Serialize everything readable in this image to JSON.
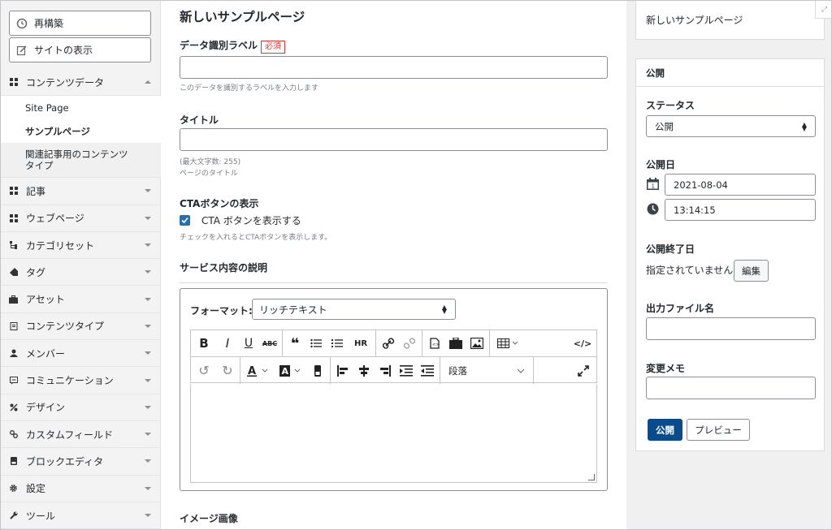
{
  "sidebar": {
    "rebuild_label": "再構築",
    "view_site_label": "サイトの表示",
    "content_data_label": "コンテンツデータ",
    "sub_items": {
      "site_page": "Site Page",
      "sample_page": "サンプルページ",
      "related": "関連記事用のコンテンツタイプ"
    },
    "items": [
      {
        "label": "記事",
        "icon": "grid-icon"
      },
      {
        "label": "ウェブページ",
        "icon": "grid-icon"
      },
      {
        "label": "カテゴリセット",
        "icon": "hierarchy-icon"
      },
      {
        "label": "タグ",
        "icon": "tag-icon"
      },
      {
        "label": "アセット",
        "icon": "briefcase-icon"
      },
      {
        "label": "コンテンツタイプ",
        "icon": "document-icon"
      },
      {
        "label": "メンバー",
        "icon": "user-icon"
      },
      {
        "label": "コミュニケーション",
        "icon": "chat-icon"
      },
      {
        "label": "デザイン",
        "icon": "design-icon"
      },
      {
        "label": "カスタムフィールド",
        "icon": "link-icon"
      },
      {
        "label": "ブロックエディタ",
        "icon": "block-icon"
      },
      {
        "label": "設定",
        "icon": "gear-icon"
      },
      {
        "label": "ツール",
        "icon": "wrench-icon"
      }
    ]
  },
  "main": {
    "page_title": "新しいサンプルページ",
    "data_label": {
      "label": "データ識別ラベル",
      "required": "必須",
      "hint": "このデータを識別するラベルを入力します"
    },
    "title_field": {
      "label": "タイトル",
      "hint1": "(最大文字数: 255)",
      "hint2": "ページのタイトル"
    },
    "cta": {
      "label": "CTAボタンの表示",
      "checkbox_label": "CTA ボタンを表示する",
      "hint": "チェックを入れるとCTAボタンを表示します。"
    },
    "service": {
      "label": "サービス内容の説明",
      "format_label": "フォーマット:",
      "format_value": "リッチテキスト",
      "paragraph": "段落",
      "hr": "HR"
    },
    "image_label": "イメージ画像"
  },
  "right": {
    "top_title": "新しいサンプルページ",
    "publish_box": {
      "heading": "公開",
      "status_label": "ステータス",
      "status_value": "公開",
      "publish_date_label": "公開日",
      "date_value": "2021-08-04",
      "time_value": "13:14:15",
      "end_date_label": "公開終了日",
      "end_date_value": "指定されていません",
      "edit_button": "編集",
      "output_file_label": "出力ファイル名",
      "memo_label": "変更メモ",
      "publish_button": "公開",
      "preview_button": "プレビュー"
    }
  },
  "colors": {
    "primary": "#0a4b8c",
    "checkbox": "#2271b1",
    "required": "#d63638"
  }
}
